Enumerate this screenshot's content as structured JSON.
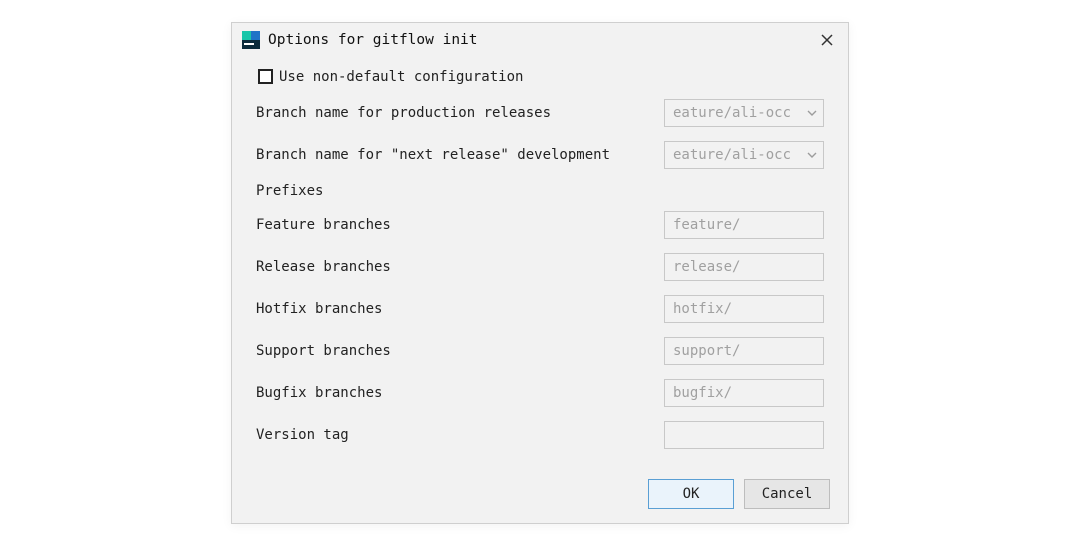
{
  "title": "Options for gitflow init",
  "checkbox": {
    "label": "Use non-default configuration",
    "checked": false
  },
  "rows": {
    "production": {
      "label": "Branch name for production releases",
      "value": "eature/ali-occ"
    },
    "next_release": {
      "label": "Branch name for \"next release\" development",
      "value": "eature/ali-occ"
    }
  },
  "prefixes_section_label": "Prefixes",
  "prefixes": {
    "feature": {
      "label": "Feature branches",
      "value": "feature/"
    },
    "release": {
      "label": "Release branches",
      "value": "release/"
    },
    "hotfix": {
      "label": "Hotfix branches",
      "value": "hotfix/"
    },
    "support": {
      "label": "Support branches",
      "value": "support/"
    },
    "bugfix": {
      "label": "Bugfix branches",
      "value": "bugfix/"
    },
    "version_tag": {
      "label": "Version tag",
      "value": ""
    }
  },
  "buttons": {
    "ok": "OK",
    "cancel": "Cancel"
  }
}
